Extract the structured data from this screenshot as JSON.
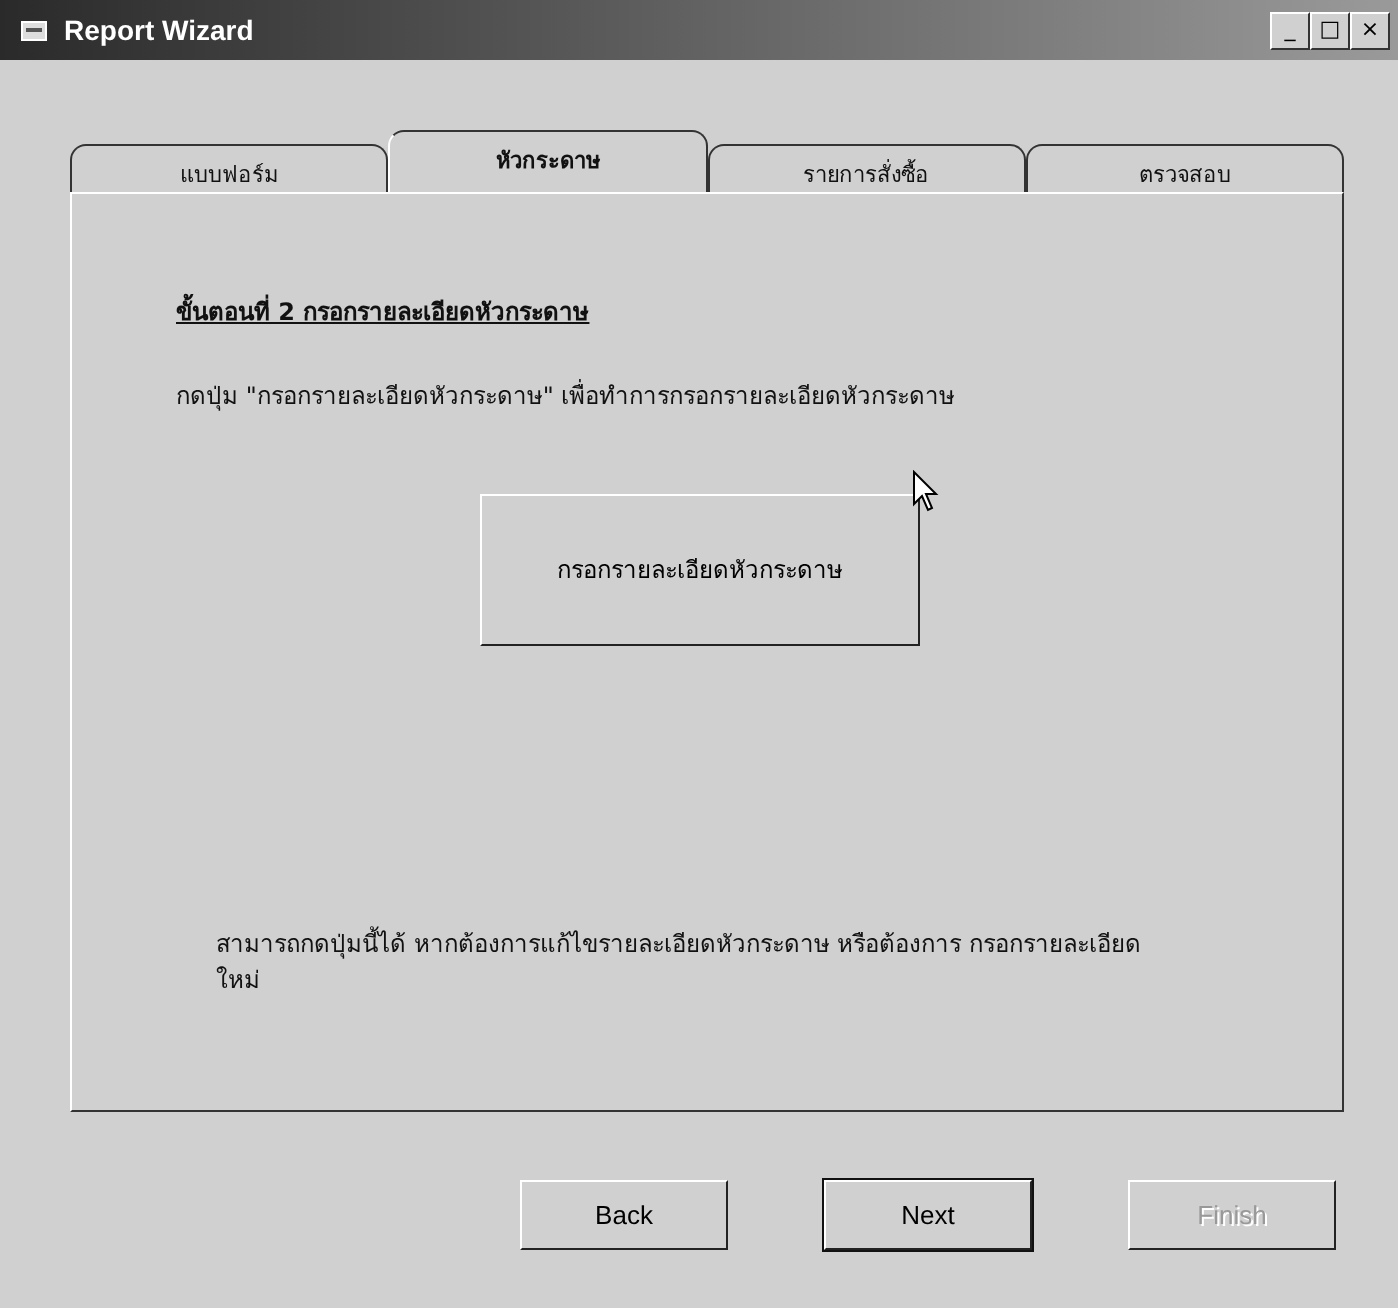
{
  "window": {
    "title": "Report Wizard",
    "controls": [
      "_",
      "□",
      "×"
    ]
  },
  "tabs": [
    {
      "label": "แบบฟอร์ม",
      "selected": false
    },
    {
      "label": "หัวกระดาษ",
      "selected": true
    },
    {
      "label": "รายการสั่งซื้อ",
      "selected": false
    },
    {
      "label": "ตรวจสอบ",
      "selected": false
    }
  ],
  "step_heading": "ขั้นตอนที่ 2 กรอกรายละเอียดหัวกระดาษ",
  "instruction": "กดปุ่ม \"กรอกรายละเอียดหัวกระดาษ\" เพื่อทำการกรอกรายละเอียดหัวกระดาษ",
  "action_button": "กรอกรายละเอียดหัวกระดาษ",
  "note": "สามารถกดปุ่มนี้ได้ หากต้องการแก้ไขรายละเอียดหัวกระดาษ หรือต้องการ กรอกรายละเอียดใหม่",
  "buttons": [
    {
      "label": "Back",
      "disabled": false,
      "default": false
    },
    {
      "label": "Next",
      "disabled": false,
      "default": true
    },
    {
      "label": "Finish",
      "disabled": true,
      "default": false
    }
  ]
}
